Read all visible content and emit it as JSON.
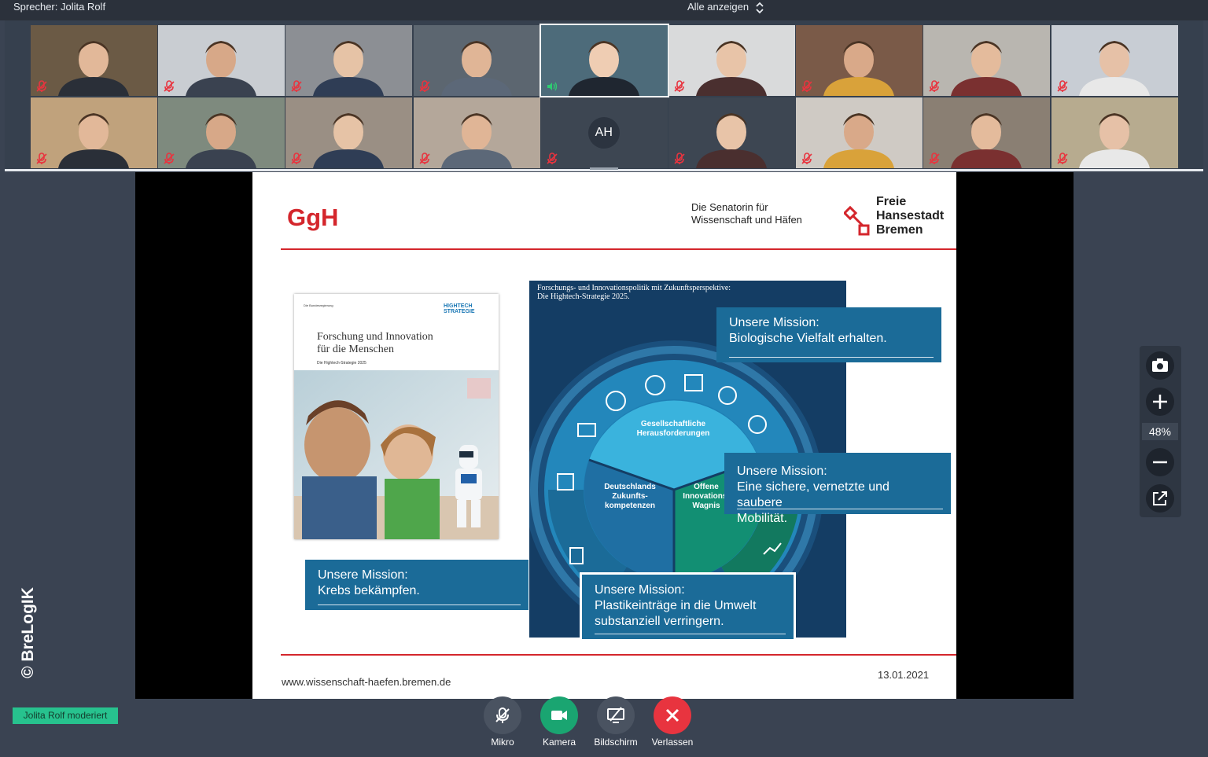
{
  "topbar": {
    "speaker": "Sprecher: Jolita Rolf",
    "show_all": "Alle anzeigen"
  },
  "gallery": {
    "avatar_initials": "AH",
    "active_speaker_index": 4
  },
  "slide": {
    "ggh": "GgH",
    "senatorin": [
      "Die Senatorin für",
      "Wissenschaft und Häfen"
    ],
    "bremen": [
      "Freie",
      "Hansestadt",
      "Bremen"
    ],
    "brochure": {
      "title_line1": "Forschung und Innovation",
      "title_line2": "für die Menschen",
      "subtitle": "Die Hightech-Strategie 2025",
      "badge_line1": "HIGHTECH",
      "badge_line2": "STRATEGIE",
      "seal": "Die Bundesregierung"
    },
    "panel": {
      "title_line1": "Forschungs- und Innovationspolitik mit Zukunftsperspektive:",
      "title_line2": "Die Hightech-Strategie 2025.",
      "center": [
        "Gesellschaftliche",
        "Herausforderungen"
      ],
      "left_segment": [
        "Deutschlands",
        "Zukunfts-",
        "kompetenzen"
      ],
      "right_segment": [
        "Offene",
        "Innovations-",
        "Wagnis"
      ]
    },
    "missions": {
      "bio_line1": "Unsere Mission:",
      "bio_line2": "Biologische Vielfalt erhalten.",
      "mob_line1": "Unsere Mission:",
      "mob_line2": "Eine sichere, vernetzte und saubere",
      "mob_line3": "Mobilität.",
      "krebs_line1": "Unsere Mission:",
      "krebs_line2": "Krebs bekämpfen.",
      "plastik_line1": "Unsere Mission:",
      "plastik_line2": "Plastikeinträge in die Umwelt",
      "plastik_line3": "substanziell verringern."
    },
    "website": "www.wissenschaft-haefen.bremen.de",
    "date": "13.01.2021"
  },
  "sidebar": {
    "zoom": "48%"
  },
  "watermark": "© BreLogIK",
  "moderator": "Jolita Rolf moderiert",
  "controls": {
    "mic": "Mikro",
    "camera": "Kamera",
    "screen": "Bildschirm",
    "leave": "Verlassen"
  },
  "colors": {
    "accent_red": "#d4262c",
    "mission_blue": "#1b6b98",
    "camera_green": "#1aa571",
    "leave_red": "#e8343f",
    "moderator_green": "#27c28e"
  }
}
